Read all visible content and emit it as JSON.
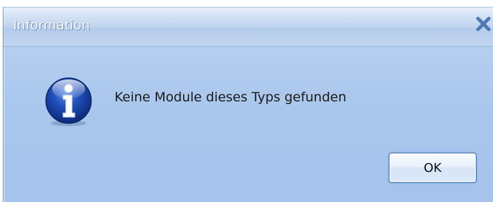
{
  "dialog": {
    "title": "Information",
    "close_icon": "close-icon",
    "icon": "information-icon",
    "message": "Keine Module dieses Typs gefunden",
    "ok_label": "OK"
  },
  "colors": {
    "title_text": "#ffffff",
    "body_background": "#a5c3ec",
    "close_x": "#4f79b3"
  }
}
